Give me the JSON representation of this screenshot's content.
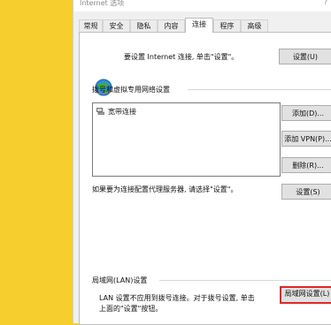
{
  "dialog": {
    "title": "Internet 选项",
    "help": "?"
  },
  "tabs": [
    {
      "label": "常规"
    },
    {
      "label": "安全"
    },
    {
      "label": "隐私"
    },
    {
      "label": "内容"
    },
    {
      "label": "连接",
      "active": true
    },
    {
      "label": "程序"
    },
    {
      "label": "高级"
    }
  ],
  "setup": {
    "text": "要设置 Internet 连接, 单击\"设置\"。",
    "button": "设置(U)"
  },
  "dialup": {
    "heading": "拨号和虚拟专用网络设置",
    "connections": [
      {
        "label": "宽带连接",
        "icon": "network-connection-icon"
      }
    ],
    "add_button": "添加(D)...",
    "add_vpn_button": "添加 VPN(P)...",
    "remove_button": "删除(R)...",
    "proxy_text": "如果要为连接配置代理服务器, 请选择\"设置\"。",
    "settings_button": "设置(S)"
  },
  "lan": {
    "heading": "局域网(LAN)设置",
    "note_line1": "LAN 设置不应用到拨号连接。对于拨号设置, 单击",
    "note_line2": "上面的\"设置\"按钮。",
    "button": "局域网设置(L)"
  },
  "colors": {
    "highlight": "#e02828",
    "background": "#f6cf2f"
  }
}
